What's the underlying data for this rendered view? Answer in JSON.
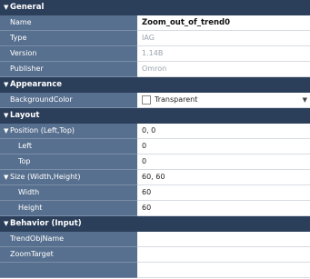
{
  "sections": {
    "general": "General",
    "appearance": "Appearance",
    "layout": "Layout",
    "behavior": "Behavior (Input)"
  },
  "props": {
    "name": {
      "label": "Name",
      "value": "Zoom_out_of_trend0"
    },
    "type": {
      "label": "Type",
      "value": "IAG"
    },
    "version": {
      "label": "Version",
      "value": "1.14B"
    },
    "publisher": {
      "label": "Publisher",
      "value": "Omron"
    },
    "bgcolor": {
      "label": "BackgroundColor",
      "value": "Transparent"
    },
    "position": {
      "label": "Position (Left,Top)",
      "value": "0, 0"
    },
    "left": {
      "label": "Left",
      "value": "0"
    },
    "top": {
      "label": "Top",
      "value": "0"
    },
    "size": {
      "label": "Size (Width,Height)",
      "value": "60, 60"
    },
    "width": {
      "label": "Width",
      "value": "60"
    },
    "height": {
      "label": "Height",
      "value": "60"
    },
    "trendobj": {
      "label": "TrendObjName",
      "value": ""
    },
    "zoomtarget": {
      "label": "ZoomTarget",
      "value": ""
    }
  },
  "icons": {
    "collapse": "triangle-down",
    "dropdown": "chevron-down"
  },
  "colors": {
    "section_bg": "#2b3e5a",
    "name_bg": "#58708f",
    "value_bg": "#ffffff"
  }
}
